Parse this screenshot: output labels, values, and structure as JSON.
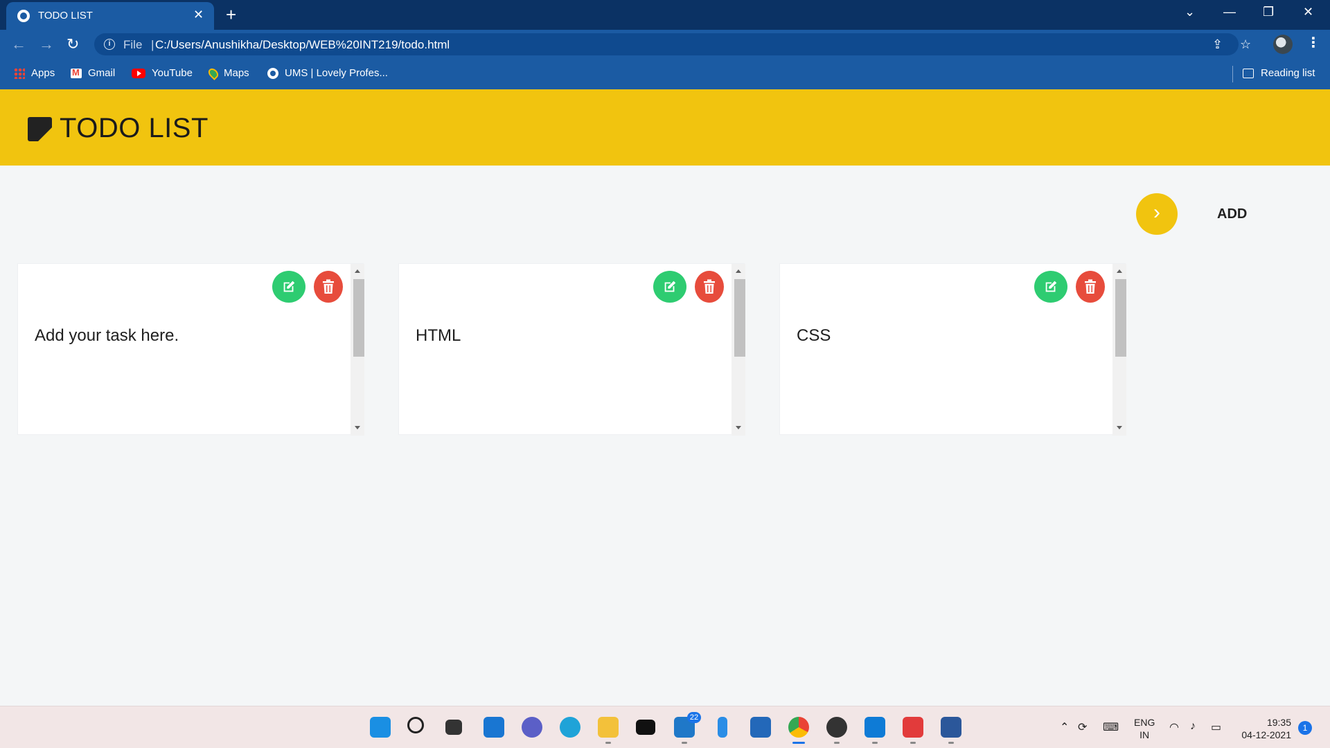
{
  "browser": {
    "tab_title": "TODO LIST",
    "tab_close": "✕",
    "new_tab": "+",
    "back": "←",
    "forward": "→",
    "reload": "↻",
    "site_info": "i",
    "file_label": "File",
    "separator": "|",
    "url": "C:/Users/Anushikha/Desktop/WEB%20INT219/todo.html",
    "share": "⇪",
    "star": "☆",
    "menu": "⋮",
    "window_controls": {
      "tab_search": "⌄",
      "minimize": "—",
      "restore": "❐",
      "close": "✕"
    }
  },
  "bookmarks": [
    {
      "label": "Apps",
      "icon": "apps-grid-icon"
    },
    {
      "label": "Gmail",
      "icon": "gmail-icon"
    },
    {
      "label": "YouTube",
      "icon": "youtube-icon"
    },
    {
      "label": "Maps",
      "icon": "maps-icon"
    },
    {
      "label": "UMS | Lovely Profes...",
      "icon": "globe-icon"
    }
  ],
  "reading_list": "Reading list",
  "app": {
    "title": "TODO LIST",
    "accent": "#f1c40f",
    "add_arrow": "›",
    "add_label": "ADD",
    "edit_color": "#2ecc71",
    "delete_color": "#e74c3c"
  },
  "notes": [
    {
      "text": "Add your task here."
    },
    {
      "text": "HTML"
    },
    {
      "text": "CSS"
    }
  ],
  "taskbar": {
    "icons": [
      "windows-start-icon",
      "search-icon",
      "task-view-icon",
      "widgets-icon",
      "teams-chat-icon",
      "edge-icon",
      "file-explorer-icon",
      "dropbox-icon",
      "mail-icon",
      "visual-studio-icon",
      "store-icon",
      "chrome-icon",
      "media-player-icon",
      "vscode-icon",
      "wps-office-icon",
      "word-icon"
    ],
    "mail_badge": "22",
    "lang_line1": "ENG",
    "lang_line2": "IN",
    "time": "19:35",
    "date": "04-12-2021",
    "notification_count": "1"
  }
}
